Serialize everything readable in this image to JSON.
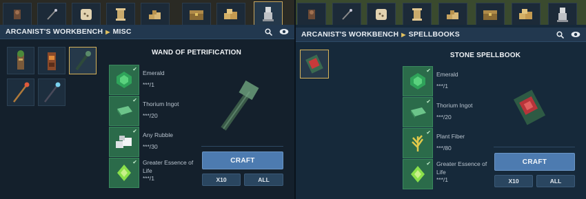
{
  "left": {
    "header": {
      "title": "ARCANIST'S WORKBENCH",
      "category": "MISC"
    },
    "items": [
      {
        "name": "Guardian Totem",
        "icon": "totem-icon"
      },
      {
        "name": "Lantern Totem",
        "icon": "lantern-icon"
      },
      {
        "name": "Wand of Petrification",
        "icon": "wand-icon",
        "selected": true
      },
      {
        "name": "Fire Staff",
        "icon": "staff-icon"
      },
      {
        "name": "Frost Staff",
        "icon": "frost-staff-icon"
      }
    ],
    "recipe": {
      "title": "WAND OF PETRIFICATION",
      "ingredients": [
        {
          "name": "Emerald",
          "amount": "***/1",
          "icon": "emerald-icon"
        },
        {
          "name": "Thorium Ingot",
          "amount": "***/20",
          "icon": "ingot-icon"
        },
        {
          "name": "Any Rubble",
          "amount": "***/30",
          "icon": "rubble-icon"
        },
        {
          "name": "Greater Essence of Life",
          "amount": "***/1",
          "icon": "essence-icon"
        }
      ],
      "craft_label": "CRAFT",
      "x10_label": "X10",
      "all_label": "ALL"
    }
  },
  "right": {
    "header": {
      "title": "ARCANIST'S WORKBENCH",
      "category": "SPELLBOOKS"
    },
    "items": [
      {
        "name": "Stone Spellbook",
        "icon": "spellbook-icon",
        "selected": true
      }
    ],
    "recipe": {
      "title": "STONE SPELLBOOK",
      "ingredients": [
        {
          "name": "Emerald",
          "amount": "***/1",
          "icon": "emerald-icon"
        },
        {
          "name": "Thorium Ingot",
          "amount": "***/20",
          "icon": "ingot-icon"
        },
        {
          "name": "Plant Fiber",
          "amount": "***/80",
          "icon": "fiber-icon"
        },
        {
          "name": "Greater Essence of Life",
          "amount": "***/1",
          "icon": "essence-icon"
        }
      ],
      "craft_label": "CRAFT",
      "x10_label": "X10",
      "all_label": "ALL"
    }
  },
  "colors": {
    "accent": "#d9b45a",
    "craft_button": "#4d7bb0",
    "ingredient_slot": "#2b6b4a",
    "header": "#22384f"
  }
}
